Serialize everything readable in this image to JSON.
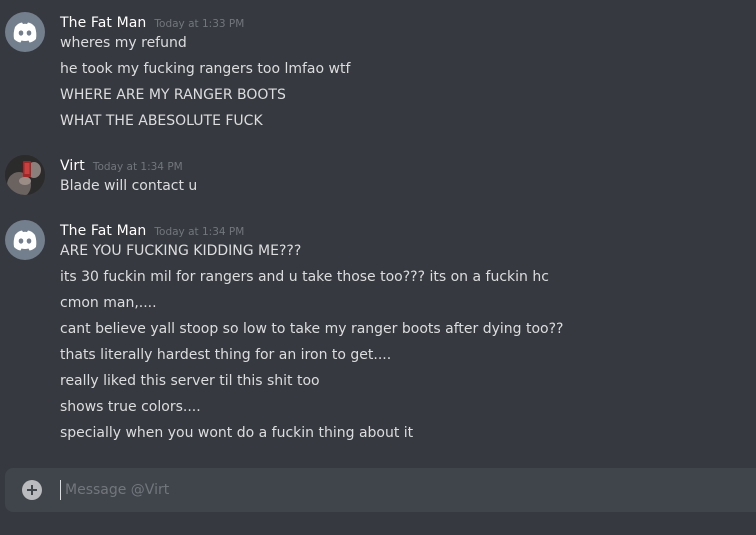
{
  "colors": {
    "background": "#36393f",
    "composer": "#40444b",
    "username": "#ffffff",
    "timestamp": "#72767d",
    "message_text": "#dcddde",
    "discord_avatar": "#747f8d"
  },
  "messages": [
    {
      "author": "The Fat Man",
      "timestamp": "Today at 1:33 PM",
      "avatar_icon": "discord-logo-icon",
      "lines": [
        "wheres my refund",
        "he took my fucking rangers too lmfao wtf",
        "WHERE ARE MY RANGER BOOTS",
        "WHAT THE ABESOLUTE FUCK"
      ]
    },
    {
      "author": "Virt",
      "timestamp": "Today at 1:34 PM",
      "avatar_icon": "user-photo-avatar",
      "lines": [
        "Blade will contact u"
      ]
    },
    {
      "author": "The Fat Man",
      "timestamp": "Today at 1:34 PM",
      "avatar_icon": "discord-logo-icon",
      "lines": [
        "ARE YOU FUCKING KIDDING ME???",
        "its 30 fuckin mil for rangers and u take those too??? its on a fuckin hc",
        "cmon man,....",
        "cant believe yall stoop so low to take my ranger boots after dying too??",
        "thats literally hardest thing for an iron to get....",
        "really liked this server til this shit too",
        "shows true colors....",
        "specially when you wont do a fuckin thing about it"
      ]
    }
  ],
  "composer": {
    "placeholder": "Message @Virt",
    "value": "",
    "add_icon": "plus-circle-icon"
  }
}
